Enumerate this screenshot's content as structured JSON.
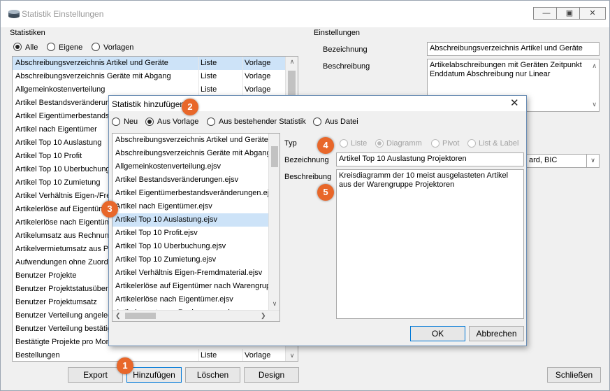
{
  "window": {
    "title": "Statistik Einstellungen"
  },
  "statistiken": {
    "group_label": "Statistiken",
    "filters": [
      {
        "label": "Alle",
        "selected": true
      },
      {
        "label": "Eigene",
        "selected": false
      },
      {
        "label": "Vorlagen",
        "selected": false
      }
    ],
    "rows": [
      {
        "name": "Abschreibungsverzeichnis Artikel und Geräte",
        "type": "Liste",
        "src": "Vorlage"
      },
      {
        "name": "Abschreibungsverzeichnis Geräte mit Abgang",
        "type": "Liste",
        "src": "Vorlage"
      },
      {
        "name": "Allgemeinkostenverteilung",
        "type": "Liste",
        "src": "Vorlage"
      },
      {
        "name": "Artikel Bestandsveränderung",
        "type": "",
        "src": ""
      },
      {
        "name": "Artikel Eigentümerbestands",
        "type": "",
        "src": ""
      },
      {
        "name": "Artikel nach Eigentümer",
        "type": "",
        "src": ""
      },
      {
        "name": "Artikel Top 10 Auslastung",
        "type": "",
        "src": ""
      },
      {
        "name": "Artikel Top 10 Profit",
        "type": "",
        "src": ""
      },
      {
        "name": "Artikel Top 10 Uberbuchung",
        "type": "",
        "src": ""
      },
      {
        "name": "Artikel Top 10 Zumietung",
        "type": "",
        "src": ""
      },
      {
        "name": "Artikel Verhältnis Eigen-/Fre",
        "type": "",
        "src": ""
      },
      {
        "name": "Artikelerlöse auf Eigentüme",
        "type": "",
        "src": ""
      },
      {
        "name": "Artikelerlöse nach Eigentüm",
        "type": "",
        "src": ""
      },
      {
        "name": "Artikelumsatz aus Rechnung",
        "type": "",
        "src": ""
      },
      {
        "name": "Artikelvermietumsatz aus Pr",
        "type": "",
        "src": ""
      },
      {
        "name": "Aufwendungen ohne Zuordn",
        "type": "",
        "src": ""
      },
      {
        "name": "Benutzer Projekte",
        "type": "",
        "src": ""
      },
      {
        "name": "Benutzer Projektstatusübers",
        "type": "",
        "src": ""
      },
      {
        "name": "Benutzer Projektumsatz",
        "type": "",
        "src": ""
      },
      {
        "name": "Benutzer Verteilung angeleg",
        "type": "",
        "src": ""
      },
      {
        "name": "Benutzer Verteilung bestätig",
        "type": "",
        "src": ""
      },
      {
        "name": "Bestätigte Projekte pro Mon",
        "type": "",
        "src": ""
      },
      {
        "name": "Bestellungen",
        "type": "Liste",
        "src": "Vorlage"
      }
    ],
    "buttons": {
      "export": "Export",
      "add": "Hinzufügen",
      "delete": "Löschen",
      "design": "Design"
    }
  },
  "einstellungen": {
    "group_label": "Einstellungen",
    "bezeichnung_label": "Bezeichnung",
    "bezeichnung_value": "Abschreibungsverzeichnis Artikel und Geräte",
    "beschreibung_label": "Beschreibung",
    "beschreibung_value": "Artikelabschreibungen mit Geräten Zeitpunkt Enddatum Abschreibung nur Linear",
    "dropdown_fragment": "ard, BIC"
  },
  "close_button": "Schließen",
  "dialog": {
    "title": "Statistik hinzufügen",
    "sources": [
      {
        "label": "Neu",
        "selected": false
      },
      {
        "label": "Aus Vorlage",
        "selected": true
      },
      {
        "label": "Aus bestehender Statistik",
        "selected": false
      },
      {
        "label": "Aus Datei",
        "selected": false
      }
    ],
    "files": [
      "Abschreibungsverzeichnis Artikel und Geräte.",
      "Abschreibungsverzeichnis Geräte mit Abgang",
      "Allgemeinkostenverteilung.ejsv",
      "Artikel Bestandsveränderungen.ejsv",
      "Artikel Eigentümerbestandsveränderungen.ejs",
      "Artikel nach Eigentümer.ejsv",
      "Artikel Top 10 Auslastung.ejsv",
      "Artikel Top 10 Profit.ejsv",
      "Artikel Top 10 Uberbuchung.ejsv",
      "Artikel Top 10 Zumietung.ejsv",
      "Artikel Verhältnis Eigen-Fremdmaterial.ejsv",
      "Artikelerlöse auf Eigentümer nach Warengrup",
      "Artikelerlöse nach Eigentümer.ejsv",
      "Artikelumsatz aus Rechnungen.ejsv"
    ],
    "typ_label": "Typ",
    "typ_options": [
      {
        "label": "Liste",
        "selected": false
      },
      {
        "label": "Diagramm",
        "selected": true
      },
      {
        "label": "Pivot",
        "selected": false
      },
      {
        "label": "List & Label",
        "selected": false
      }
    ],
    "bezeichnung_label": "Bezeichnung",
    "bezeichnung_value": "Artikel Top 10 Auslastung Projektoren",
    "beschreibung_label": "Beschreibung",
    "beschreibung_value": "Kreisdiagramm der 10 meist ausgelasteten Artikel aus der Warengruppe Projektoren",
    "ok": "OK",
    "cancel": "Abbrechen"
  },
  "badges": [
    "1",
    "2",
    "3",
    "4",
    "5"
  ],
  "colors": {
    "badge": "#e8672a",
    "selection": "#cde3f8",
    "focus_border": "#0078d7"
  }
}
